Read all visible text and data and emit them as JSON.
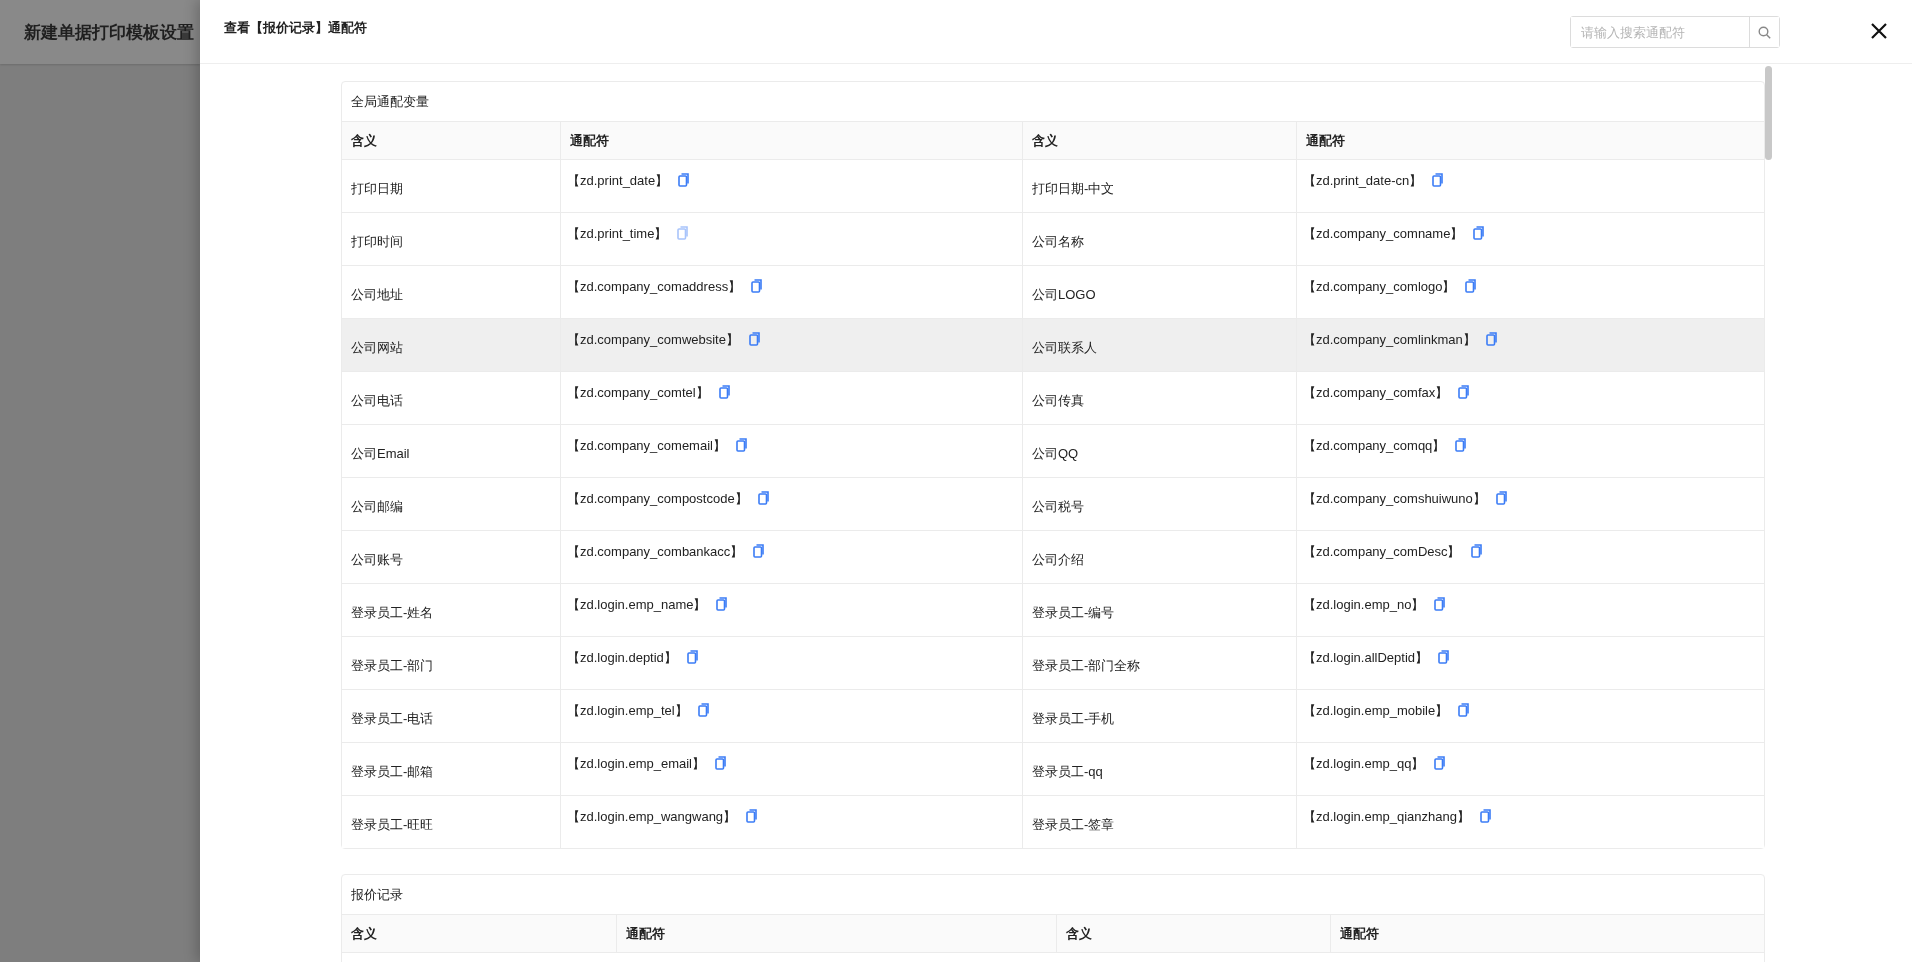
{
  "background_page": {
    "title": "新建单据打印模板设置"
  },
  "drawer": {
    "title": "查看【报价记录】通配符",
    "search": {
      "placeholder": "请输入搜索通配符"
    }
  },
  "sections": [
    {
      "title": "全局通配变量",
      "columns": [
        "含义",
        "通配符",
        "含义",
        "通配符"
      ],
      "rows": [
        {
          "highlighted": false,
          "cells": [
            {
              "kind": "text",
              "text": "打印日期"
            },
            {
              "kind": "code",
              "text": "【zd.print_date】",
              "dimmed": false
            },
            {
              "kind": "text",
              "text": "打印日期-中文"
            },
            {
              "kind": "code",
              "text": "【zd.print_date-cn】",
              "dimmed": false
            }
          ]
        },
        {
          "highlighted": false,
          "cells": [
            {
              "kind": "text",
              "text": "打印时间"
            },
            {
              "kind": "code",
              "text": "【zd.print_time】",
              "dimmed": true
            },
            {
              "kind": "text",
              "text": "公司名称"
            },
            {
              "kind": "code",
              "text": "【zd.company_comname】",
              "dimmed": false
            }
          ]
        },
        {
          "highlighted": false,
          "cells": [
            {
              "kind": "text",
              "text": "公司地址"
            },
            {
              "kind": "code",
              "text": "【zd.company_comaddress】",
              "dimmed": false
            },
            {
              "kind": "text",
              "text": "公司LOGO"
            },
            {
              "kind": "code",
              "text": "【zd.company_comlogo】",
              "dimmed": false
            }
          ]
        },
        {
          "highlighted": true,
          "cells": [
            {
              "kind": "text",
              "text": "公司网站"
            },
            {
              "kind": "code",
              "text": "【zd.company_comwebsite】",
              "dimmed": false
            },
            {
              "kind": "text",
              "text": "公司联系人"
            },
            {
              "kind": "code",
              "text": "【zd.company_comlinkman】",
              "dimmed": false
            }
          ]
        },
        {
          "highlighted": false,
          "cells": [
            {
              "kind": "text",
              "text": "公司电话"
            },
            {
              "kind": "code",
              "text": "【zd.company_comtel】",
              "dimmed": false
            },
            {
              "kind": "text",
              "text": "公司传真"
            },
            {
              "kind": "code",
              "text": "【zd.company_comfax】",
              "dimmed": false
            }
          ]
        },
        {
          "highlighted": false,
          "cells": [
            {
              "kind": "text",
              "text": "公司Email"
            },
            {
              "kind": "code",
              "text": "【zd.company_comemail】",
              "dimmed": false
            },
            {
              "kind": "text",
              "text": "公司QQ"
            },
            {
              "kind": "code",
              "text": "【zd.company_comqq】",
              "dimmed": false
            }
          ]
        },
        {
          "highlighted": false,
          "cells": [
            {
              "kind": "text",
              "text": "公司邮编"
            },
            {
              "kind": "code",
              "text": "【zd.company_compostcode】",
              "dimmed": false
            },
            {
              "kind": "text",
              "text": "公司税号"
            },
            {
              "kind": "code",
              "text": "【zd.company_comshuiwuno】",
              "dimmed": false
            }
          ]
        },
        {
          "highlighted": false,
          "cells": [
            {
              "kind": "text",
              "text": "公司账号"
            },
            {
              "kind": "code",
              "text": "【zd.company_combankacc】",
              "dimmed": false
            },
            {
              "kind": "text",
              "text": "公司介绍"
            },
            {
              "kind": "code",
              "text": "【zd.company_comDesc】",
              "dimmed": false
            }
          ]
        },
        {
          "highlighted": false,
          "cells": [
            {
              "kind": "text",
              "text": "登录员工-姓名"
            },
            {
              "kind": "code",
              "text": "【zd.login.emp_name】",
              "dimmed": false
            },
            {
              "kind": "text",
              "text": "登录员工-编号"
            },
            {
              "kind": "code",
              "text": "【zd.login.emp_no】",
              "dimmed": false
            }
          ]
        },
        {
          "highlighted": false,
          "cells": [
            {
              "kind": "text",
              "text": "登录员工-部门"
            },
            {
              "kind": "code",
              "text": "【zd.login.deptid】",
              "dimmed": false
            },
            {
              "kind": "text",
              "text": "登录员工-部门全称"
            },
            {
              "kind": "code",
              "text": "【zd.login.allDeptid】",
              "dimmed": false
            }
          ]
        },
        {
          "highlighted": false,
          "cells": [
            {
              "kind": "text",
              "text": "登录员工-电话"
            },
            {
              "kind": "code",
              "text": "【zd.login.emp_tel】",
              "dimmed": false
            },
            {
              "kind": "text",
              "text": "登录员工-手机"
            },
            {
              "kind": "code",
              "text": "【zd.login.emp_mobile】",
              "dimmed": false
            }
          ]
        },
        {
          "highlighted": false,
          "cells": [
            {
              "kind": "text",
              "text": "登录员工-邮箱"
            },
            {
              "kind": "code",
              "text": "【zd.login.emp_email】",
              "dimmed": false
            },
            {
              "kind": "text",
              "text": "登录员工-qq"
            },
            {
              "kind": "code",
              "text": "【zd.login.emp_qq】",
              "dimmed": false
            }
          ]
        },
        {
          "highlighted": false,
          "cells": [
            {
              "kind": "text",
              "text": "登录员工-旺旺"
            },
            {
              "kind": "code",
              "text": "【zd.login.emp_wangwang】",
              "dimmed": false
            },
            {
              "kind": "text",
              "text": "登录员工-签章"
            },
            {
              "kind": "code",
              "text": "【zd.login.emp_qianzhang】",
              "dimmed": false
            }
          ]
        }
      ]
    },
    {
      "title": "报价记录",
      "columns": [
        "含义",
        "通配符",
        "含义",
        "通配符"
      ]
    }
  ]
}
